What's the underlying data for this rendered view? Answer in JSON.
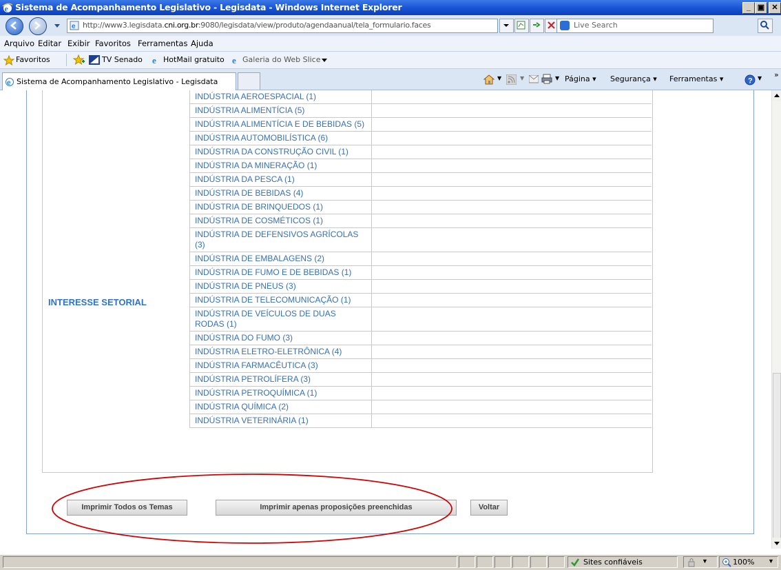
{
  "window": {
    "title": "Sistema de Acompanhamento Legislativo - Legisdata - Windows Internet Explorer",
    "controls": [
      "_",
      "3",
      "X"
    ]
  },
  "address_bar": {
    "url_prefix": "http://www3.legisdata.",
    "url_domain": "cni.org.br",
    "url_suffix": ":9080/legisdata/view/produto/agendaanual/tela_formulario.faces",
    "search_placeholder": "Live Search"
  },
  "menu": [
    "Arquivo",
    "Editar",
    "Exibir",
    "Favoritos",
    "Ferramentas",
    "Ajuda"
  ],
  "favorites_bar": {
    "favorites_label": "Favoritos",
    "links": [
      "TV Senado",
      "HotMail gratuito",
      "Galeria do Web Slice"
    ]
  },
  "tabs": {
    "active_label": "Sistema de Acompanhamento Legislativo - Legisdata"
  },
  "command_bar": [
    "Página",
    "Segurança",
    "Ferramentas"
  ],
  "section": {
    "label": "INTERESSE SETORIAL",
    "items": [
      "INDÚSTRIA AEROESPACIAL (1)",
      "INDÚSTRIA ALIMENTÍCIA (5)",
      "INDÚSTRIA ALIMENTÍCIA E DE BEBIDAS (5)",
      "INDÚSTRIA AUTOMOBILÍSTICA (6)",
      "INDÚSTRIA DA CONSTRUÇÃO CIVIL (1)",
      "INDÚSTRIA DA MINERAÇÃO (1)",
      "INDÚSTRIA DA PESCA (1)",
      "INDÚSTRIA DE BEBIDAS (4)",
      "INDÚSTRIA DE BRINQUEDOS (1)",
      "INDÚSTRIA DE COSMÉTICOS (1)",
      "INDÚSTRIA DE DEFENSIVOS AGRÍCOLAS (3)",
      "INDÚSTRIA DE EMBALAGENS (2)",
      "INDÚSTRIA DE FUMO E DE BEBIDAS (1)",
      "INDÚSTRIA DE PNEUS (3)",
      "INDÚSTRIA DE TELECOMUNICAÇÃO (1)",
      "INDÚSTRIA DE VEÍCULOS DE DUAS RODAS (1)",
      "INDÚSTRIA DO FUMO (3)",
      "INDÚSTRIA ELETRO-ELETRÔNICA (4)",
      "INDÚSTRIA FARMACÊUTICA (3)",
      "INDÚSTRIA PETROLÍFERA (3)",
      "INDÚSTRIA PETROQUÍMICA (1)",
      "INDÚSTRIA QUÍMICA (2)",
      "INDÚSTRIA VETERINÁRIA (1)"
    ]
  },
  "buttons": {
    "print_all": "Imprimir Todos os Temas",
    "print_filled": "Imprimir apenas proposições preenchidas",
    "back": "Voltar"
  },
  "status_bar": {
    "zone": "Sites confiáveis",
    "zoom": "100%"
  },
  "colors": {
    "link_blue": "#3670b8",
    "section_blue": "#2f73c9",
    "annotation_red": "#d40000"
  }
}
